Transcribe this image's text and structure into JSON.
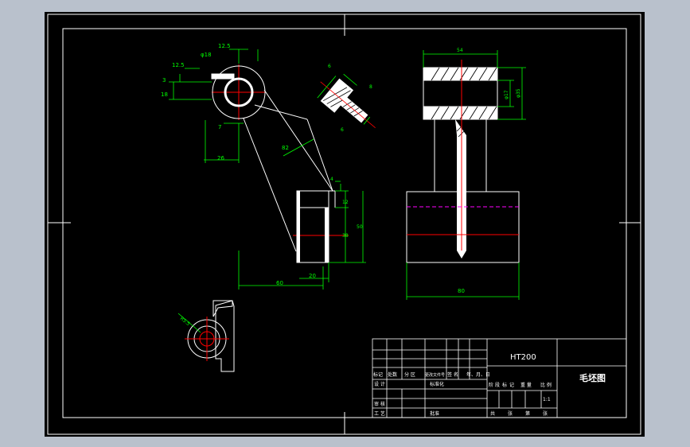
{
  "colors": {
    "background": "#b9c1cc",
    "sheet": "#000000",
    "outline": "#ffffff",
    "dimension": "#00ff00",
    "center_line": "#ff0000",
    "hidden_line": "#ff00ff",
    "hatch": "#ffffff"
  },
  "dimensions": {
    "phi18": "φ18",
    "d12_5_left": "12.5",
    "d12_5_top": "12.5",
    "d3": "3",
    "d18": "18",
    "d7": "7",
    "d26": "26",
    "d82": "82",
    "d60": "60",
    "d20": "20",
    "d12": "12",
    "d38": "38",
    "d50": "50",
    "d4": "4",
    "d6a": "6",
    "d6b": "6",
    "d8": "8",
    "d54": "54",
    "phi17": "φ17",
    "phi35": "φ35",
    "d80": "80",
    "r5": "R5.5"
  },
  "title_block": {
    "material": "HT200",
    "drawing_title": "毛坯图",
    "scale": "1:1",
    "header_labels": [
      "标记",
      "处数",
      "分 区",
      "更改文件号",
      "签 名",
      "年、月、日"
    ],
    "designer_label": "设 计",
    "standardization_label": "标准化",
    "stage_marks": [
      "阶",
      "段",
      "标",
      "记"
    ],
    "weight_label": "重 量",
    "scale_label": "比 例",
    "reviewer_label": "审 核",
    "process_label": "工 艺",
    "approve_label": "批准",
    "sheet_info": [
      "共",
      "张",
      "第",
      "张"
    ]
  }
}
